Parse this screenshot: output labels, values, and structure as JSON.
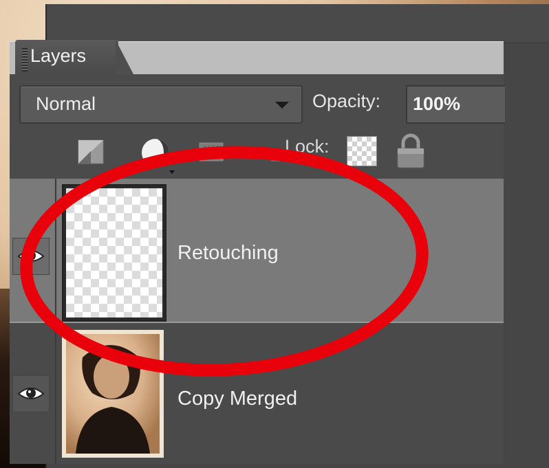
{
  "panel": {
    "tab_label": "Layers",
    "blend_mode": "Normal",
    "opacity_label": "Opacity:",
    "opacity_value": "100%",
    "lock_label": "Lock:"
  },
  "layers": [
    {
      "name": "Retouching",
      "visible": true,
      "selected": true,
      "thumbnail": "transparent"
    },
    {
      "name": "Copy Merged",
      "visible": true,
      "selected": false,
      "thumbnail": "portrait-photo"
    }
  ],
  "annotation": {
    "shape": "ellipse",
    "color": "#e8000a",
    "target": "Retouching"
  },
  "colors": {
    "panel_bg": "#4b4b4b",
    "selected_row": "#7a7a7a",
    "tab_strip": "#bdbdbd"
  }
}
